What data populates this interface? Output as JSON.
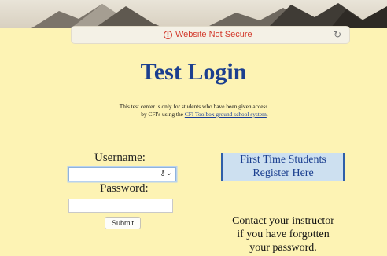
{
  "browser": {
    "security_text": "Website Not Secure",
    "security_icon": "info-circle-icon",
    "reload_icon": "reload-icon"
  },
  "page": {
    "title": "Test Login",
    "notice_line1": "This test center is only for students who have been given access",
    "notice_line2_prefix": "by CFI's using the ",
    "notice_link": "CFI Toolbox ground school system",
    "notice_line2_suffix": "."
  },
  "form": {
    "username_label": "Username:",
    "username_value": "",
    "password_label": "Password:",
    "password_value": "",
    "submit_label": "Submit",
    "keychain_icon": "key-icon"
  },
  "register": {
    "line1": "First Time Students",
    "line2": "Register Here"
  },
  "contact": {
    "line1": "Contact your instructor",
    "line2": "if you have forgotten",
    "line3": "your password."
  },
  "colors": {
    "page_bg": "#fdf3b4",
    "title": "#1b3f8f",
    "warning": "#d33a2c",
    "register_bg": "#cde0f0"
  }
}
